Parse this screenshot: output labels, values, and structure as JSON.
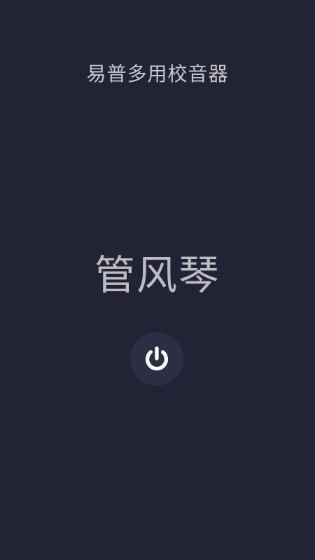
{
  "header": {
    "title": "易普多用校音器"
  },
  "main": {
    "instrument": "管风琴",
    "power_icon": "power-icon"
  },
  "colors": {
    "background": "#232336",
    "button_background": "#2b2f45",
    "icon": "#ffffff",
    "text": "#c8c8cf"
  }
}
